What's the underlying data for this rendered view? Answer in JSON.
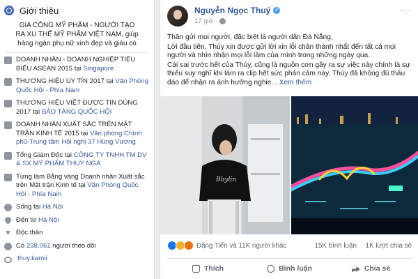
{
  "intro": {
    "title": "Giới thiệu",
    "bio": "GIA CÔNG MỸ PHẨM - NGƯỜI TẠO RA XU THẾ MỸ PHẨM VIỆT NAM, giúp hàng ngàn phụ nữ xinh đẹp và giàu có",
    "items": [
      {
        "icon": "award-icon",
        "text": "DOANH NHÂN - DOANH NGHIỆP TIÊU BIỂU ASEAN 2015 tại ",
        "link": "Singapore"
      },
      {
        "icon": "award-icon",
        "text": "THƯƠNG HIỆU UY TÍN 2017 tại ",
        "link": "Văn Phòng Quốc Hội - Phía Nam"
      },
      {
        "icon": "award-icon",
        "text": "THƯƠNG HIỆU VIỆT ĐƯỢC TIN DÙNG 2017 tại ",
        "link": "BẢO TÀNG QUỐC HỘI"
      },
      {
        "icon": "award-icon",
        "text": "DOANH NHÂN XUẤT SẮC TRÊN MẶT TRẬN KINH TẾ 2015 tại ",
        "link": "Văn phòng Chính phủ-Trung tâm Hội nghị 37 Hùng Vương"
      },
      {
        "icon": "briefcase-icon",
        "text": "Tổng Giám Đốc tại ",
        "link": "CÔNG TY TNHH TM DV & SX MỸ PHẨM THUỲ NGA"
      },
      {
        "icon": "briefcase-icon",
        "text": "Từng làm Bằng vàng Doanh nhân Xuất sắc trên Mặt trận Kinh tế tại ",
        "link": "Văn Phòng Quốc Hội - Phía Nam"
      },
      {
        "icon": "home-icon",
        "text": "Sống tại ",
        "link": "Hà Nội"
      },
      {
        "icon": "location-icon",
        "text": "Đến từ ",
        "link": "Hà Nội"
      },
      {
        "icon": "heart-icon",
        "text": "Độc thân",
        "link": ""
      },
      {
        "icon": "followers-icon",
        "text": "Có ",
        "link": "238.061",
        "after": " người theo dõi"
      },
      {
        "icon": "link-icon",
        "text": "",
        "link": "thuy.kamii"
      }
    ]
  },
  "post": {
    "author": "Nguyễn Ngọc Thuý",
    "time": "17 giờ",
    "paragraphs": [
      "Thân gửi mọi người, đặc biệt là người dân Đà Nẵng,",
      "Lời đầu tiên, Thúy xin được gửi lời xin lỗi chân thành nhất đến tất cả mọi người và nhìn nhận mọi lỗi lầm của mình trong những ngày qua.",
      "Cái sai trước hết của Thúy, cũng là nguồn cơn gây ra sự việc này chính là sự thiếu suy nghĩ khi làm ra clip hết sức phản cảm này. Thúy đã không đủ thấu đáo để nhận ra ảnh hưởng nghie..."
    ],
    "see_more": "Xem thêm",
    "reactions_text": "Đặng Tiến và 11K người khác",
    "comments": "15K bình luận",
    "shares": "1K lượt chia sẻ",
    "actions": {
      "like": "Thích",
      "comment": "Bình luận",
      "share": "Chia sẻ"
    },
    "photo_caption_text": "Bbylin"
  },
  "colors": {
    "link": "#385898",
    "brand": "#4267b2",
    "muted": "#90949c"
  }
}
